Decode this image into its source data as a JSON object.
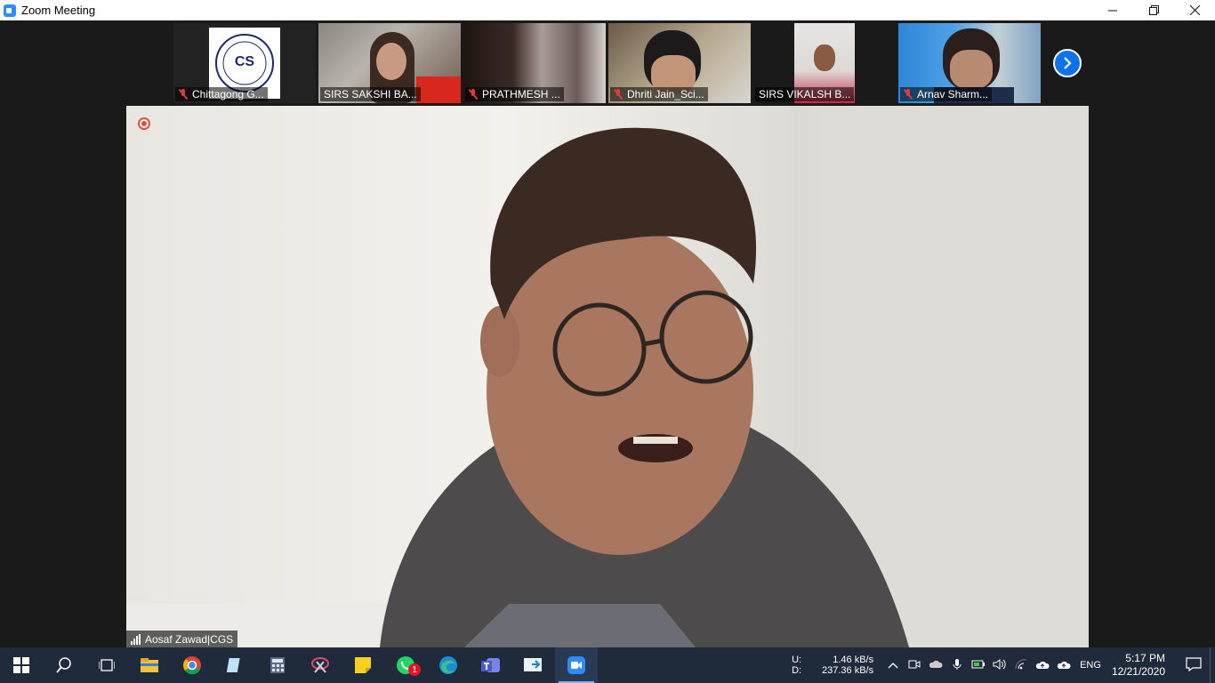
{
  "window": {
    "title": "Zoom Meeting"
  },
  "participants": [
    {
      "name": "Chittagong G...",
      "muted": true
    },
    {
      "name": "SIRS SAKSHI BA...",
      "muted": false
    },
    {
      "name": "PRATHMESH ...",
      "muted": true
    },
    {
      "name": "Dhriti Jain_Sci...",
      "muted": true
    },
    {
      "name": "SIRS VIKALSH B...",
      "muted": false
    },
    {
      "name": "Arnav Sharm...",
      "muted": true
    }
  ],
  "logo_text": "CS",
  "speaker": {
    "name": "Aosaf Zawad|CGS"
  },
  "taskbar": {
    "apps": [
      "windows-start",
      "search",
      "task-view",
      "file-explorer",
      "chrome",
      "notepad",
      "calculator",
      "snipping-tool",
      "sticky-notes",
      "whatsapp",
      "edge",
      "teams",
      "remote-desktop",
      "zoom"
    ],
    "whatsapp_badge": "1",
    "net_up_label": "U:",
    "net_up": "1.46 kB/s",
    "net_down_label": "D:",
    "net_down": "237.36 kB/s",
    "language": "ENG",
    "time": "5:17 PM",
    "date": "12/21/2020"
  },
  "colors": {
    "zoom_blue": "#2d8cff",
    "muted_red": "#e03b3b",
    "taskbar": "#1f2a3a"
  }
}
